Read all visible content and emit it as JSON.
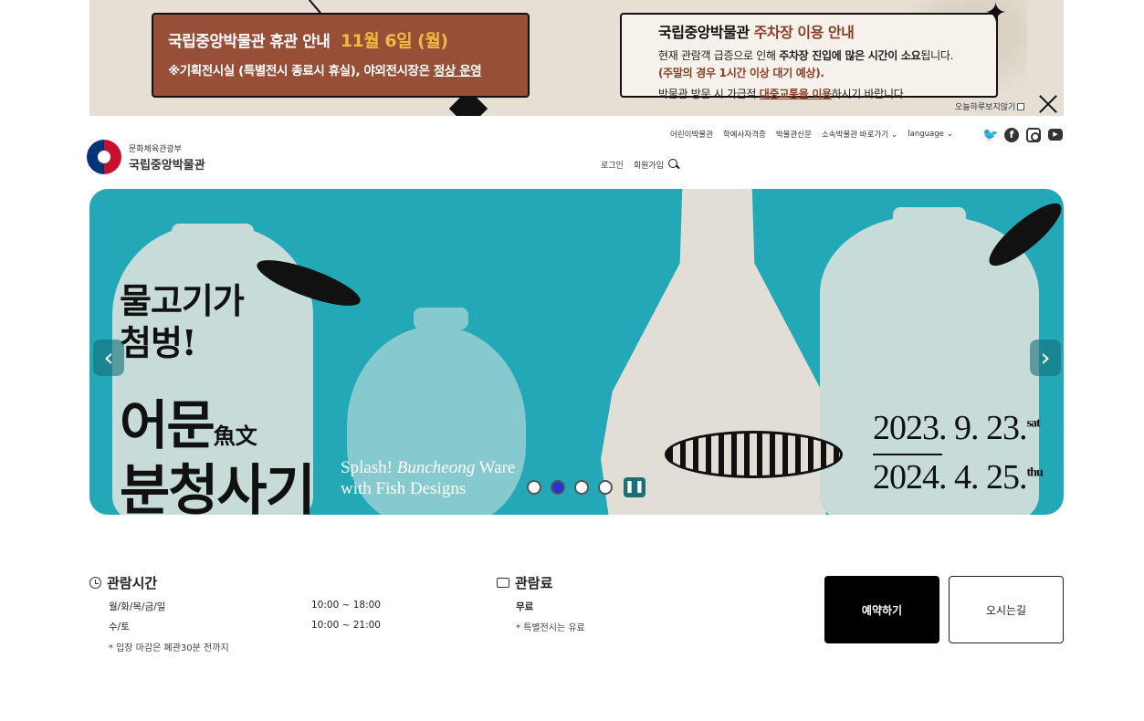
{
  "popup": {
    "closure": {
      "title_prefix": "국립중앙박물관",
      "title_main": "휴관 안내",
      "date": "11월 6일 (월)",
      "notice_prefix": "※기획전시실 (특별전시 종료시 휴실), 야외전시장은",
      "notice_underline": "정상 운영"
    },
    "parking": {
      "title_prefix": "국립중앙박물관",
      "title_highlight": "주차장 이용 안내",
      "line1_a": "현재 관람객 급증으로 인해",
      "line1_b": "주차장 진입에 많은 시간이 소요",
      "line1_c": "됩니다.",
      "line2": "(주말의 경우 1시간 이상 대기 예상).",
      "line3_a": "박물관 방문 시 가급적",
      "line3_b": "대중교통을 이용",
      "line3_c": "하시기 바랍니다."
    },
    "dismiss_label": "오늘하루보지않기"
  },
  "header": {
    "logo_ministry": "문화체육관광부",
    "logo_name": "국립중앙박물관",
    "util_links": [
      "어린이박물관",
      "학예사자격증",
      "박물관신문",
      "소속박물관 바로가기",
      "language"
    ],
    "social": [
      "twitter-icon",
      "facebook-icon",
      "instagram-icon",
      "youtube-icon"
    ],
    "login": "로그인",
    "signup": "회원가입"
  },
  "hero": {
    "line1": "물고기가",
    "line2": "첨벙!",
    "title_a": "어문",
    "title_hanja": "魚文",
    "title_b": "분청사기",
    "en_a": "Splash!",
    "en_italic": "Buncheong",
    "en_b": "Ware",
    "en_c": "with Fish Designs",
    "date_start": "2023. 9. 23.",
    "date_start_day": "sat",
    "date_end": "2024. 4. 25.",
    "date_end_day": "thu",
    "slide_count": 4,
    "active_slide": 2
  },
  "info": {
    "hours_title": "관람시간",
    "hours": [
      {
        "days": "월/화/목/금/일",
        "time": "10:00 ~ 18:00"
      },
      {
        "days": "수/토",
        "time": "10:00 ~ 21:00"
      }
    ],
    "hours_note": "* 입장 마감은 폐관30분 전까지",
    "fee_title": "관람료",
    "fee_value": "무료",
    "fee_note": "* 특별전시는 유료",
    "reserve_label": "예약하기",
    "directions_label": "오시는길"
  }
}
